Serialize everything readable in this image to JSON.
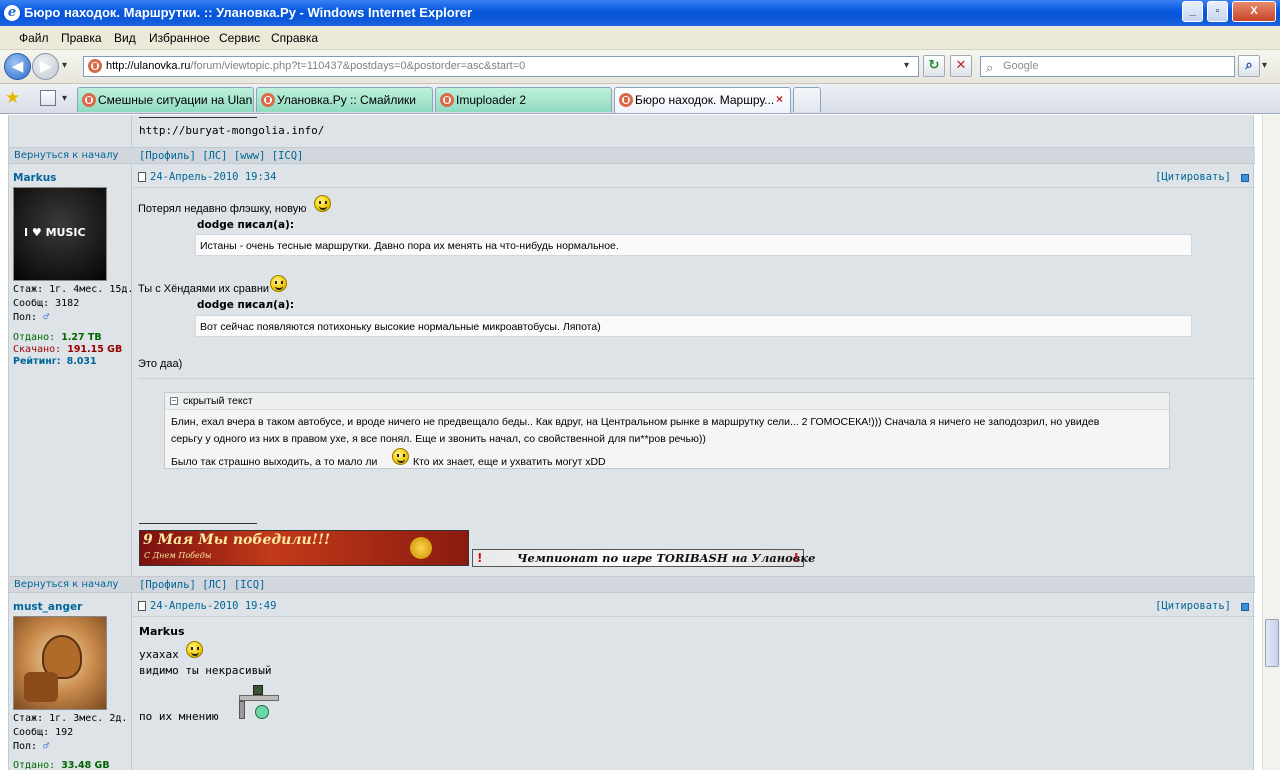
{
  "window": {
    "title": "Бюро находок. Маршрутки. :: Улановка.Ру - Windows Internet Explorer",
    "logo_glyph": "e",
    "controls": [
      "_",
      "▫",
      "X"
    ]
  },
  "menu": [
    "Файл",
    "Правка",
    "Вид",
    "Избранное",
    "Сервис",
    "Справка"
  ],
  "nav": {
    "address_domain": "http://ulanovka.ru",
    "address_rest": "/forum/viewtopic.php?t=110437&postdays=0&postorder=asc&start=0",
    "search_placeholder": "Google",
    "back_glyph": "◀",
    "forward_glyph": "▶",
    "refresh_glyph": "↻",
    "stop_glyph": "✕",
    "dropdown_glyph": "▾",
    "search_glyph": "⌕"
  },
  "tabs": [
    {
      "label": "Смешные ситуации на Ulan..."
    },
    {
      "label": "Улановка.Ру :: Смайлики"
    },
    {
      "label": "Imuploader 2"
    },
    {
      "label": "Бюро находок. Маршру...",
      "active": true
    }
  ],
  "tabs_close_glyph": "×",
  "prev_post_tail": {
    "link": "http://buryat-mongolia.info/",
    "back_to_top": "Вернуться к началу",
    "links": "[Профиль] [ЛС] [www] [ICQ]"
  },
  "post1": {
    "author": "Markus",
    "avatar_text": "I ♥ MUSIC",
    "stats": {
      "stazh": "Стаж: 1г. 4мес. 15д.",
      "soobsch": "Сообщ: 3182",
      "pol": "Пол:",
      "otdano_label": "Отдано:",
      "otdano_value": "1.27 TB",
      "skachano_label": "Скачано:",
      "skachano_value": "191.15 GB",
      "rating_label": "Рейтинг:",
      "rating_value": "8.031"
    },
    "date": "24-Апрель-2010 19:34",
    "quote_btn": "[Цитировать]",
    "line1": "Потерял недавно флэшку, новую",
    "quote1_author": "dodge писал(а):",
    "quote1_text": "Истаны - очень тесные маршрутки. Давно пора их менять на что-нибудь нормальное.",
    "line2": "Ты с Хёндаями их сравни",
    "quote2_author": "dodge писал(а):",
    "quote2_text": "Вот сейчас появляются потихоньку высокие нормальные микроавтобусы. Ляпота)",
    "line3": "Это даа)",
    "spoiler_title": "скрытый текст",
    "spoiler_line1": "Блин, ехал вчера в таком автобусе, и вроде ничего не предвещало беды.. Как вдруг, на Центральном рынке в маршрутку сели... 2 ГОМОСЕКА!))) Сначала я ничего не заподозрил, но увидев",
    "spoiler_line2": "серьгу у одного из них в правом ухе, я все понял. Еще и звонить начал, со свойственной для пи**ров речью))",
    "spoiler_line3a": "Было так страшно выходить, а то мало ли",
    "spoiler_line3b": "Кто их знает, еще и ухватить могут xDD",
    "banner1": "9 Мая  Мы победили!!!",
    "banner1_sub": "С Днем Победы",
    "banner2": "Чемпионат по игре TORIBASH на Улановке",
    "back_to_top": "Вернуться к началу",
    "links": "[Профиль] [ЛС] [ICQ]"
  },
  "post2": {
    "author": "must_anger",
    "stats": {
      "stazh": "Стаж: 1г. 3мес. 2д.",
      "soobsch": "Сообщ: 192",
      "pol": "Пол:",
      "otdano_label": "Отдано:",
      "otdano_value": "33.48 GB"
    },
    "date": "24-Апрель-2010 19:49",
    "quote_btn": "[Цитировать]",
    "name_ref": "Markus",
    "line1": "ухахах",
    "line2": "видимо ты некрасивый",
    "line3": "по их мнению"
  },
  "colors": {
    "link": "#006699",
    "forum_bg": "#dee3e7",
    "bar_bg": "#d1d7dc",
    "upload_green": "#006600",
    "download_red": "#990000"
  }
}
